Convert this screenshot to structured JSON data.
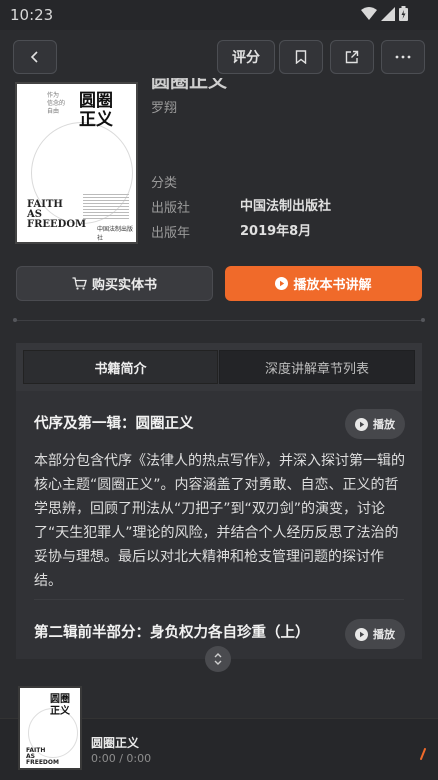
{
  "status_bar": {
    "time": "10:23"
  },
  "toolbar": {
    "rate_label": "评分"
  },
  "book": {
    "title_cut": "圆圈正义",
    "author": "罗翔",
    "cover": {
      "title": "圆圈\n正义",
      "series_text": "作为\n信念的\n自由",
      "english": "FAITH\nAS\nFREEDOM",
      "publisher": "中国法制出版社"
    },
    "meta": [
      {
        "label": "分类",
        "value": ""
      },
      {
        "label": "出版社",
        "value": "中国法制出版社"
      },
      {
        "label": "出版年",
        "value": "2019年8月"
      }
    ]
  },
  "actions": {
    "buy_label": "购买实体书",
    "play_all_label": "播放本书讲解"
  },
  "tabs": [
    {
      "label": "书籍简介",
      "active": true
    },
    {
      "label": "深度讲解章节列表",
      "active": false
    }
  ],
  "sections": [
    {
      "title": "代序及第一辑：圆圈正义",
      "play_label": "播放",
      "description": "本部分包含代序《法律人的热点写作》，并深入探讨第一辑的核心主题“圆圈正义”。内容涵盖了对勇敢、自恋、正义的哲学思辨，回顾了刑法从“刀把子”到“双刃剑”的演变，讨论了“天生犯罪人”理论的风险，并结合个人经历反思了法治的妥协与理想。最后以对北大精神和枪支管理问题的探讨作结。"
    },
    {
      "title": "第二辑前半部分：身负权力各自珍重（上）",
      "play_label": "播放"
    }
  ],
  "player": {
    "title": "圆圈正义",
    "time": "0:00 / 0:00"
  },
  "colors": {
    "accent": "#f06a2a",
    "background": "#2b2c2f"
  }
}
